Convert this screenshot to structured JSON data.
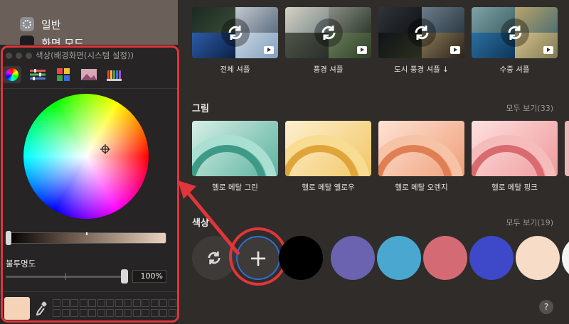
{
  "sidebar": {
    "items": [
      {
        "label": "일반",
        "icon": "gear-icon"
      },
      {
        "label": "화면 모드",
        "icon": "appearance-icon"
      }
    ]
  },
  "color_panel": {
    "title": "색상(배경화면(시스템 설정))",
    "tabs": [
      "color-wheel-icon",
      "sliders-icon",
      "palette-icon",
      "image-palette-icon",
      "pencils-icon"
    ],
    "opacity_label": "불투명도",
    "opacity_value": "100%",
    "current_color": "#f5d3b8"
  },
  "shuffle": {
    "items": [
      {
        "label": "전체 셔플"
      },
      {
        "label": "풍경 셔플"
      },
      {
        "label": "도시 풍경 셔플 ↓"
      },
      {
        "label": "수중 셔플"
      }
    ]
  },
  "pictures": {
    "title": "그림",
    "see_all": "모두 보기(33)",
    "items": [
      {
        "label": "헬로 메탈 그린",
        "color": "#6fc6b5"
      },
      {
        "label": "헬로 메탈 옐로우",
        "color": "#f1c265"
      },
      {
        "label": "헬로 메탈 오렌지",
        "color": "#f2a27b"
      },
      {
        "label": "헬로 메탈 핑크",
        "color": "#f0a2a0"
      }
    ]
  },
  "colors": {
    "title": "색상",
    "see_all": "모두 보기(19)",
    "swatches": [
      "#000000",
      "#6b62b0",
      "#4aa8d0",
      "#d46b74",
      "#3d49c8",
      "#f7dcc7"
    ],
    "add_symbol": "+"
  },
  "help_label": "?"
}
